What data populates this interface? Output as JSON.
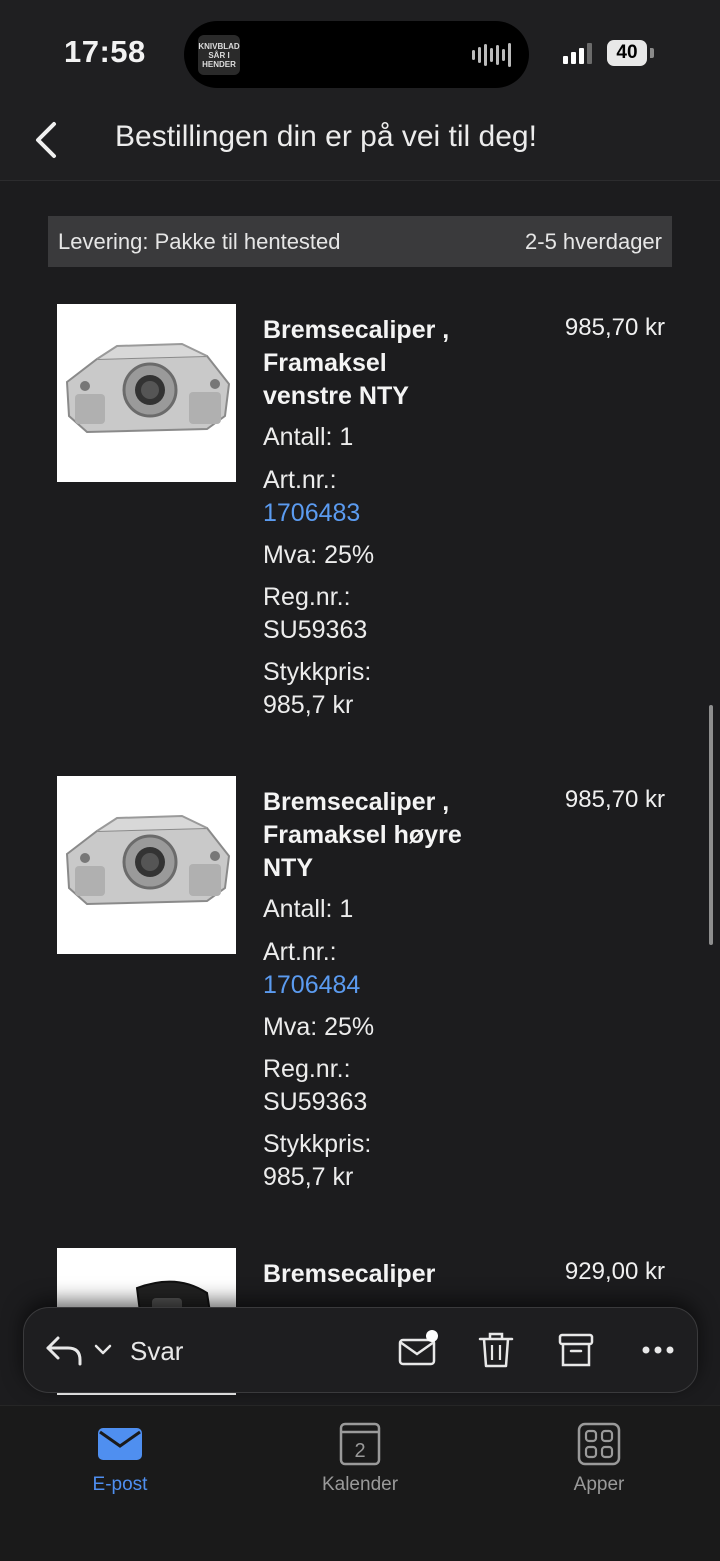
{
  "status_bar": {
    "time": "17:58",
    "battery": "40",
    "island_text": "KNIVBLAD SÅR I HENDER"
  },
  "header": {
    "title": "Bestillingen din er på vei til deg!"
  },
  "delivery": {
    "method": "Levering: Pakke til hentested",
    "time": "2-5 hverdager"
  },
  "items": [
    {
      "name": "Bremsecaliper , Framaksel venstre NTY",
      "price": "985,70 kr",
      "quantity": "Antall: 1",
      "art_label": "Art.nr.:",
      "art_nr": "1706483",
      "vat": "Mva: 25%",
      "reg_label": "Reg.nr.:",
      "reg_nr": "SU59363",
      "unit_label": "Stykkpris:",
      "unit_price": "985,7 kr"
    },
    {
      "name": "Bremsecaliper , Framaksel høyre NTY",
      "price": "985,70 kr",
      "quantity": "Antall: 1",
      "art_label": "Art.nr.:",
      "art_nr": "1706484",
      "vat": "Mva: 25%",
      "reg_label": "Reg.nr.:",
      "reg_nr": "SU59363",
      "unit_label": "Stykkpris:",
      "unit_price": "985,7 kr"
    },
    {
      "name": "Bremsecaliper",
      "price": "929,00 kr"
    }
  ],
  "toolbar": {
    "reply_label": "Svar",
    "icons": [
      "reply-icon",
      "chevron-down-icon",
      "mark-unread-icon",
      "trash-icon",
      "archive-icon",
      "more-icon"
    ]
  },
  "tabbar": {
    "tabs": [
      {
        "label": "E-post",
        "icon": "mail-icon",
        "active": true
      },
      {
        "label": "Kalender",
        "icon": "calendar-icon",
        "badge": "2"
      },
      {
        "label": "Apper",
        "icon": "apps-icon"
      }
    ]
  },
  "colors": {
    "accent": "#4f8ff0",
    "link": "#5b9bf0",
    "background": "#1c1c1e"
  }
}
